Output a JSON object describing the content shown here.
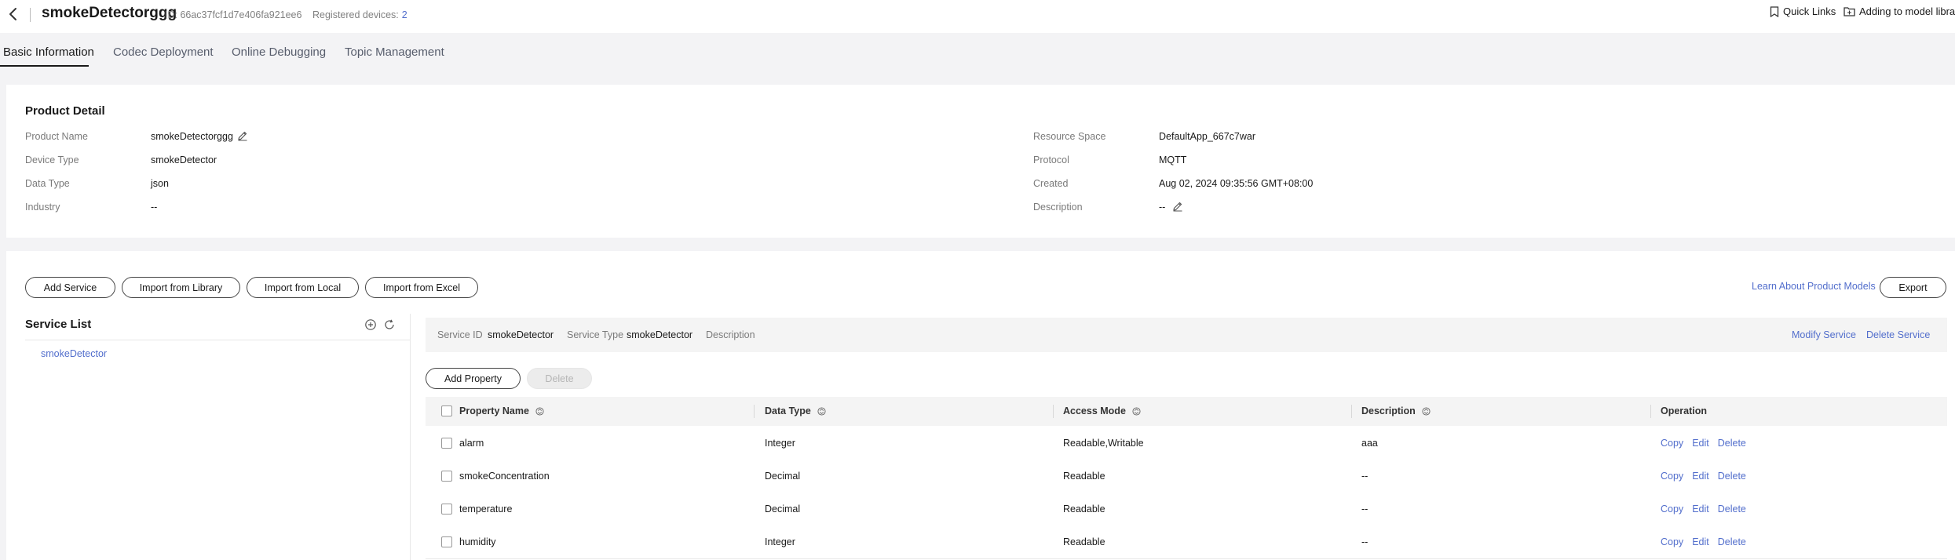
{
  "header": {
    "title": "smokeDetectorggg",
    "id_text": "ID: 66ac37fcf1d7e406fa921ee6",
    "registered_label": "Registered devices:",
    "registered_count": "2",
    "quick_links": "Quick Links",
    "add_to_library": "Adding to model library"
  },
  "tabs": [
    {
      "label": "Basic Information",
      "active": true
    },
    {
      "label": "Codec Deployment",
      "active": false
    },
    {
      "label": "Online Debugging",
      "active": false
    },
    {
      "label": "Topic Management",
      "active": false
    }
  ],
  "product_detail": {
    "title": "Product Detail",
    "left": [
      {
        "label": "Product Name",
        "value": "smokeDetectorggg"
      },
      {
        "label": "Device Type",
        "value": "smokeDetector"
      },
      {
        "label": "Data Type",
        "value": "json"
      },
      {
        "label": "Industry",
        "value": "--"
      }
    ],
    "right": [
      {
        "label": "Resource Space",
        "value": "DefaultApp_667c7war"
      },
      {
        "label": "Protocol",
        "value": "MQTT"
      },
      {
        "label": "Created",
        "value": "Aug 02, 2024 09:35:56 GMT+08:00"
      },
      {
        "label": "Description",
        "value": "--"
      }
    ]
  },
  "toolbar": {
    "add_service": "Add Service",
    "import_library": "Import from Library",
    "import_local": "Import from Local",
    "import_excel": "Import from Excel",
    "learn_link": "Learn About Product Models",
    "export": "Export"
  },
  "service_list": {
    "title": "Service List",
    "items": [
      "smokeDetector"
    ]
  },
  "service_bar": {
    "id_label": "Service ID",
    "id_value": "smokeDetector",
    "type_label": "Service Type",
    "type_value": "smokeDetector",
    "desc_label": "Description",
    "modify": "Modify Service",
    "delete": "Delete Service"
  },
  "property_actions": {
    "add": "Add Property",
    "delete": "Delete"
  },
  "table": {
    "headers": [
      "Property Name",
      "Data Type",
      "Access Mode",
      "Description",
      "Operation"
    ],
    "rows": [
      {
        "name": "alarm",
        "type": "Integer",
        "access": "Readable,Writable",
        "description": "aaa"
      },
      {
        "name": "smokeConcentration",
        "type": "Decimal",
        "access": "Readable",
        "description": "--"
      },
      {
        "name": "temperature",
        "type": "Decimal",
        "access": "Readable",
        "description": "--"
      },
      {
        "name": "humidity",
        "type": "Integer",
        "access": "Readable",
        "description": "--"
      }
    ],
    "ops": [
      "Copy",
      "Edit",
      "Delete"
    ]
  },
  "colors": {
    "accent": "#526ecc",
    "text": "#191919",
    "muted": "#7a7a7a",
    "background": "#f3f3f5"
  }
}
